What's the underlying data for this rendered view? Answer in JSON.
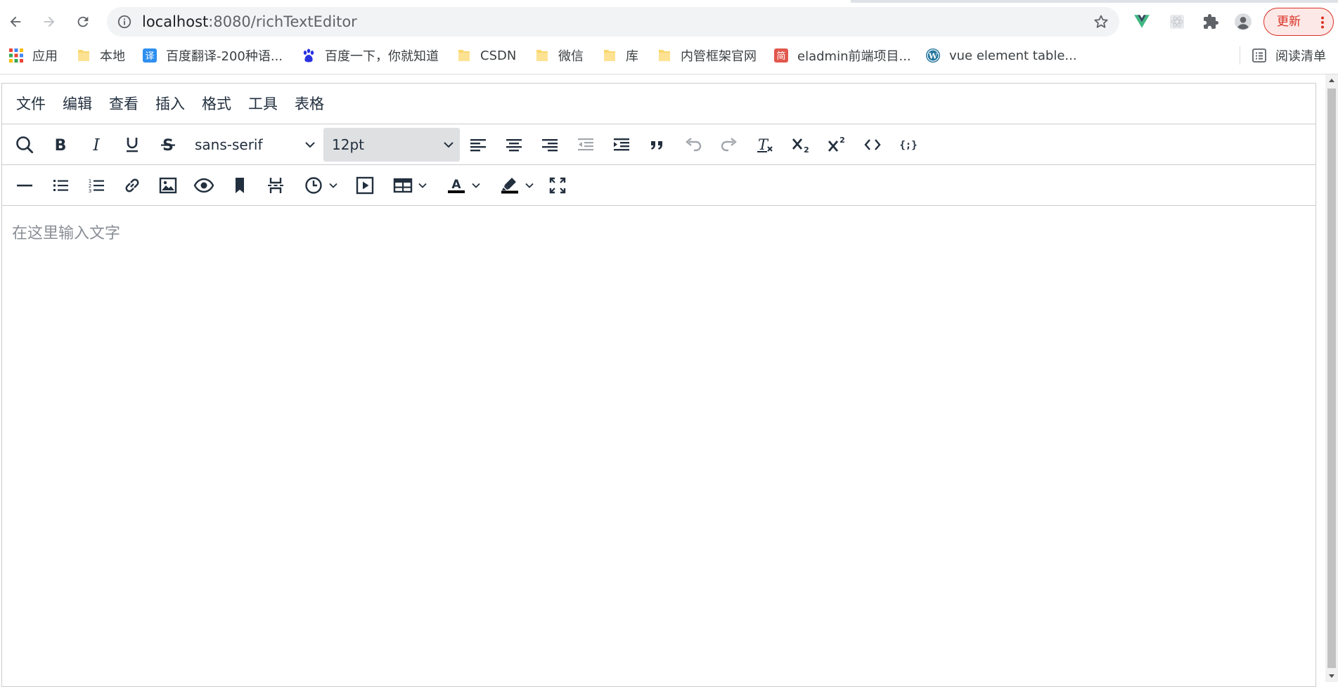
{
  "browser": {
    "url_host": "localhost",
    "url_rest": ":8080/richTextEditor",
    "update_label": "更新"
  },
  "bookmarks": [
    {
      "label": "应用",
      "icon": "apps-grid-icon"
    },
    {
      "label": "本地",
      "icon": "folder-icon"
    },
    {
      "label": "百度翻译-200种语...",
      "icon": "baidu-translate-icon"
    },
    {
      "label": "百度一下，你就知道",
      "icon": "baidu-paw-icon"
    },
    {
      "label": "CSDN",
      "icon": "folder-icon"
    },
    {
      "label": "微信",
      "icon": "folder-icon"
    },
    {
      "label": "库",
      "icon": "folder-icon"
    },
    {
      "label": "内管框架官网",
      "icon": "folder-icon"
    },
    {
      "label": "eladmin前端项目...",
      "icon": "jian-icon"
    },
    {
      "label": "vue element table...",
      "icon": "wordpress-icon"
    },
    {
      "label": "阅读清单",
      "icon": "reading-list-icon"
    }
  ],
  "editor": {
    "menu": [
      "文件",
      "编辑",
      "查看",
      "插入",
      "格式",
      "工具",
      "表格"
    ],
    "font_family": "sans-serif",
    "font_size": "12pt",
    "placeholder": "在这里输入文字",
    "toolbar1_icons": [
      "search-icon",
      "bold-icon",
      "italic-icon",
      "underline-icon",
      "strikethrough-icon",
      "align-left-icon",
      "align-center-icon",
      "align-right-icon",
      "outdent-icon",
      "indent-icon",
      "blockquote-icon",
      "undo-icon",
      "redo-icon",
      "remove-format-icon",
      "subscript-icon",
      "superscript-icon",
      "code-icon",
      "code-sample-icon"
    ],
    "toolbar2_icons": [
      "horizontal-rule-icon",
      "bullet-list-icon",
      "numbered-list-icon",
      "link-icon",
      "image-icon",
      "preview-icon",
      "bookmark-icon",
      "page-break-icon",
      "insert-datetime-icon",
      "media-icon",
      "table-icon",
      "text-color-icon",
      "highlight-color-icon",
      "fullscreen-icon"
    ]
  },
  "colors": {
    "toolbar_icon": "#222f3e",
    "border": "#cccccc",
    "update_red": "#d93025",
    "placeholder": "#8a8f96"
  }
}
